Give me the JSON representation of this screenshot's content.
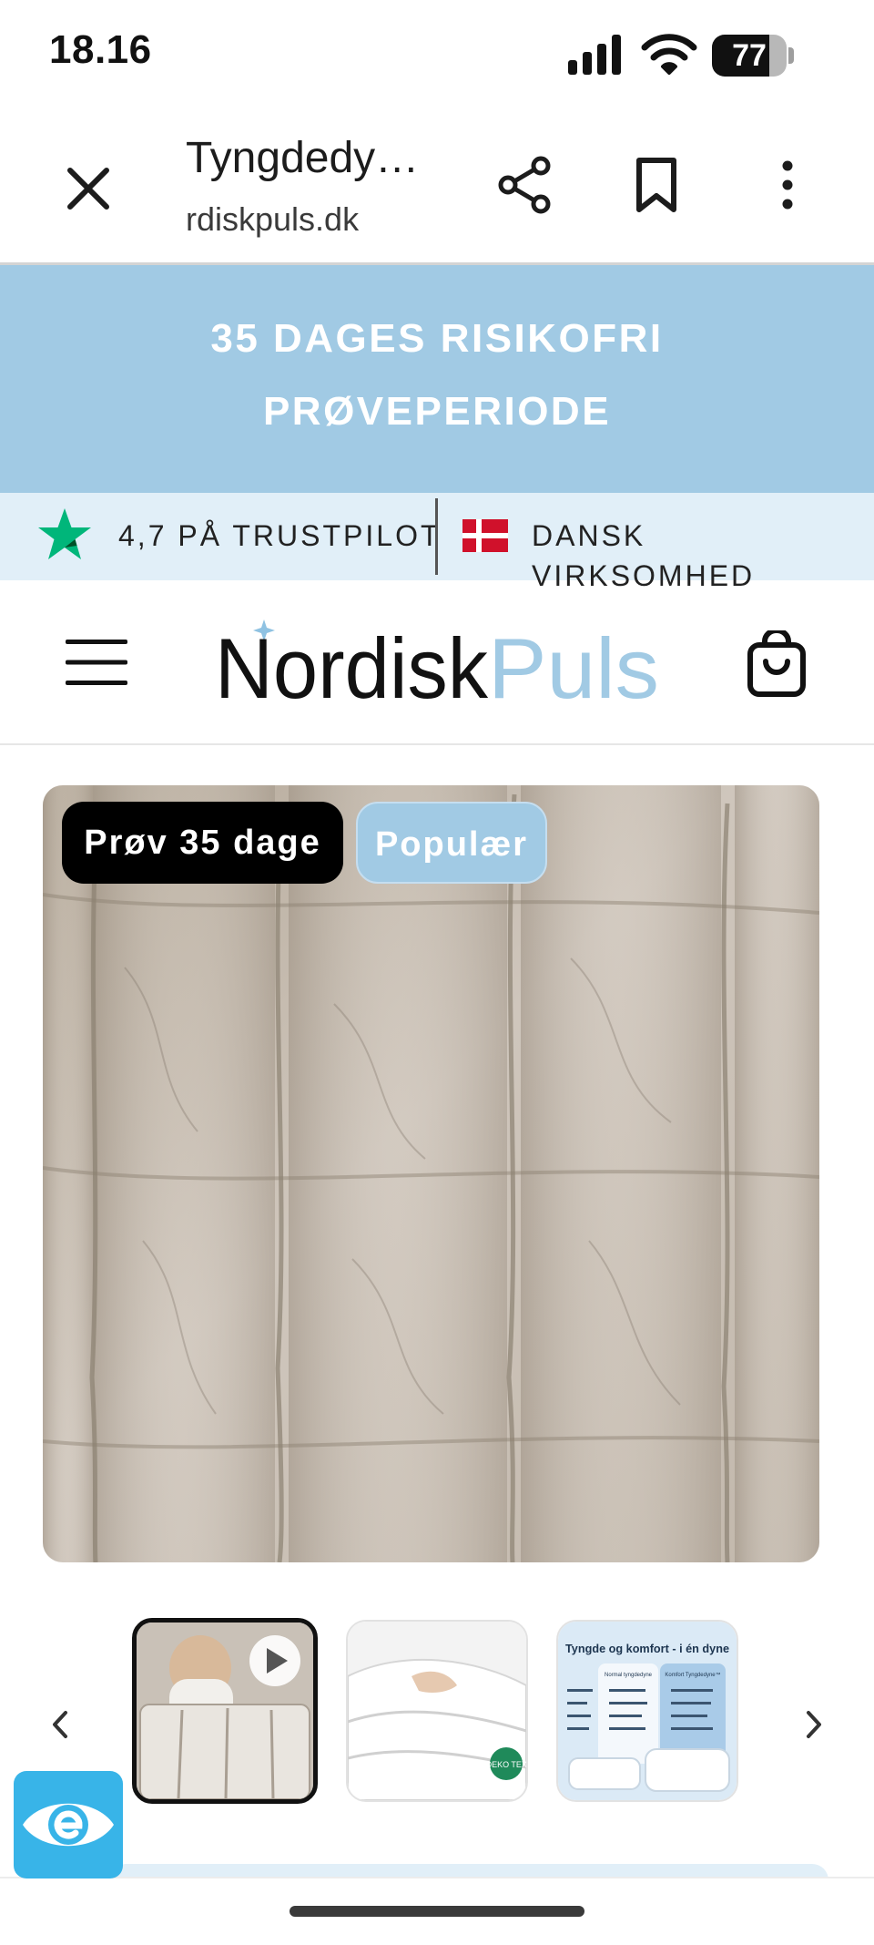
{
  "status_bar": {
    "time": "18.16",
    "battery_percent": "77",
    "battery_level": 0.77
  },
  "browser": {
    "page_title": "Tyngdedy…",
    "url": "rdiskpuls.dk",
    "icons": [
      "close-icon",
      "share-icon",
      "bookmark-icon",
      "more-vertical-icon"
    ]
  },
  "promo_banner": {
    "line1": "35 DAGES RISIKOFRI",
    "line2": "PRØVEPERIODE"
  },
  "trust_bar": {
    "trustpilot": "4,7 PÅ TRUSTPILOT",
    "company": "DANSK VIRKSOMHED"
  },
  "header": {
    "logo_part1": "Nordisk",
    "logo_part2": "Puls",
    "icons": [
      "hamburger-menu-icon",
      "shopping-bag-icon"
    ]
  },
  "product": {
    "badges": {
      "trial": "Prøv 35 dage",
      "popular": "Populær"
    },
    "thumbnails": {
      "thumb3_title": "Tyngde og komfort - i én dyne",
      "thumb3_col1": "Normal tyngdedyne",
      "thumb3_col2": "Komfort Tyngdedyne™",
      "thumb2_badge": "OEKO TEX"
    }
  },
  "colors": {
    "brand_blue": "#a1cae4",
    "trust_bar_bg": "#e1eff8",
    "trustpilot_green": "#00b67a",
    "accessibility_blue": "#38b4e8"
  }
}
